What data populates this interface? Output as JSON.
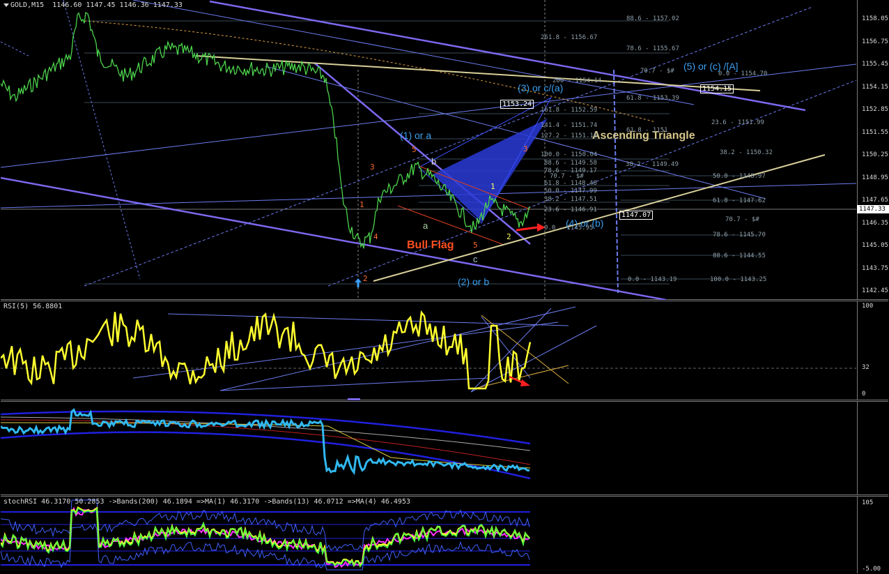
{
  "main": {
    "symbol": "GOLD,M15",
    "ohlc": "1146.60 1147.45 1146.36 1147.33",
    "price_ticks": [
      "1158.05",
      "1156.75",
      "1155.45",
      "1154.15",
      "1152.85",
      "1151.55",
      "1150.25",
      "1148.95",
      "1147.65",
      "1146.35",
      "1145.05",
      "1143.75",
      "1142.45"
    ],
    "current_price": "1147.33",
    "boxes": {
      "b1": "1153.24",
      "b2": "1154.15",
      "b3": "1147.07"
    },
    "annotations": {
      "ascending_triangle": "Ascending Triangle",
      "bull_flag": "Bull Flag",
      "wave1": "(1) or a",
      "wave2": "(2) or b",
      "wave3": "(3) or c/(a)",
      "wave4": "(4) or (b)",
      "wave5": "(5) or (c) /[A]",
      "a": "a",
      "b": "b",
      "c": "c",
      "n1": "1",
      "n2": "2",
      "n3": "3",
      "n4": "4",
      "n5": "5"
    },
    "fib_right": [
      "88.6 - 1157.02",
      "78.6 - 1155.67",
      "70.7 - $#",
      "0.0 - 1154.70",
      "61.8 - 1153.39",
      "23.6 - 1151.99",
      "38.2 - 1150.32",
      "50.0 - 1148.97",
      "61.8 - 1147.62",
      "70.7 - $#",
      "78.6 - 1145.70",
      "88.6 - 1144.55",
      "0.0 - 1143.19",
      "100.0 - 1143.25"
    ],
    "fib_mid": [
      "261.8 - 1156.67",
      "200 - 1154.14",
      "161.8 - 1152.59",
      "141.4 - 1151.74",
      "127.2 - 1151.16",
      "100.0 - 1150.04",
      "88.6 - 1149.58",
      "78.6 - 1149.17",
      "70.7 - $#",
      "61.8 - 1148.48",
      "50.0 - 1147.99",
      "38.2 - 1147.51",
      "23.6 - 1146.91",
      "0.0 - 1145.95",
      "38.2 - 1149.49",
      "61.8 - 1151"
    ]
  },
  "rsi": {
    "label": "RSI(5) 56.8801",
    "ticks": [
      "100",
      "32",
      "0"
    ]
  },
  "stoch": {
    "label": "stochRSI 46.3170 50.2853 ->Bands(200) 46.1894 =>MA(1) 46.3170 ->Bands(13) 46.0712 =>MA(4) 46.4953",
    "ticks": [
      "105",
      "-5.00"
    ]
  }
}
